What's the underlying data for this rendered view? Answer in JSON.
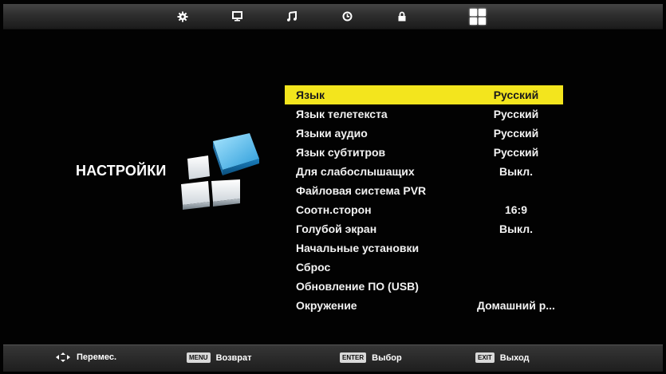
{
  "top_tabs": [
    {
      "icon": "gear-icon",
      "active": false
    },
    {
      "icon": "monitor-icon",
      "active": false
    },
    {
      "icon": "music-note-icon",
      "active": false
    },
    {
      "icon": "clock-icon",
      "active": false
    },
    {
      "icon": "lock-icon",
      "active": false
    },
    {
      "icon": "grid-icon",
      "active": true
    }
  ],
  "section": {
    "title": "НАСТРОЙКИ",
    "icon": "settings-cubes-icon"
  },
  "menu": {
    "items": [
      {
        "label": "Язык",
        "value": "Русский",
        "selected": true
      },
      {
        "label": "Язык телетекста",
        "value": "Русский"
      },
      {
        "label": "Языки аудио",
        "value": "Русский"
      },
      {
        "label": "Язык субтитров",
        "value": "Русский"
      },
      {
        "label": "Для слабослышащих",
        "value": "Выкл."
      },
      {
        "label": "Файловая система PVR",
        "value": ""
      },
      {
        "label": "Соотн.сторон",
        "value": "16:9"
      },
      {
        "label": "Голубой экран",
        "value": "Выкл."
      },
      {
        "label": "Начальные установки",
        "value": ""
      },
      {
        "label": "Сброс",
        "value": ""
      },
      {
        "label": "Обновление ПО (USB)",
        "value": ""
      },
      {
        "label": "Окружение",
        "value": "Домашний р..."
      }
    ]
  },
  "bottom_hints": {
    "move": {
      "icon": "arrows-icon",
      "label": "Перемес."
    },
    "back": {
      "key": "MENU",
      "label": "Возврат"
    },
    "select": {
      "key": "ENTER",
      "label": "Выбор"
    },
    "exit": {
      "key": "EXIT",
      "label": "Выход"
    }
  },
  "colors": {
    "highlight": "#f3e51d",
    "background": "#020202",
    "text": "#f2f2f2"
  }
}
